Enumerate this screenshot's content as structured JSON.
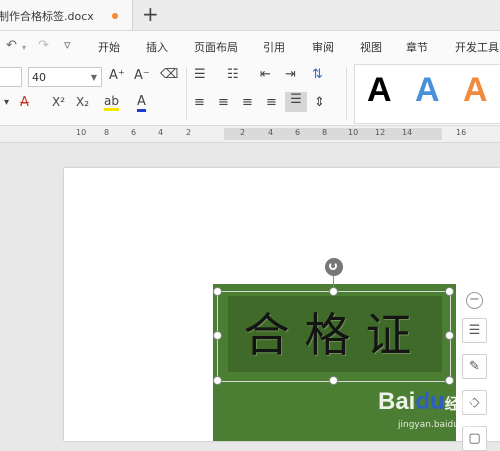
{
  "tabbar": {
    "doc_title": "制作合格标签.docx",
    "new_tab": "+"
  },
  "menu": {
    "items": [
      "开始",
      "插入",
      "页面布局",
      "引用",
      "审阅",
      "视图",
      "章节",
      "开发工具"
    ],
    "undo": "↶",
    "redo": "↷",
    "more": "▿"
  },
  "ribbon": {
    "font_size": "40",
    "grow_font": "A⁺",
    "shrink_font": "A⁻",
    "clear_format": "⌫",
    "strikethrough": "A",
    "superscript": "X²",
    "subscript": "X₂",
    "highlight": "ab",
    "font_color": "A",
    "styles_preview": [
      "A",
      "A",
      "A"
    ]
  },
  "ruler": {
    "numbers": [
      "10",
      "8",
      "6",
      "4",
      "2",
      "2",
      "4",
      "6",
      "8",
      "10",
      "12",
      "14",
      "16"
    ]
  },
  "document": {
    "wordart_text": "合格证"
  },
  "watermark": {
    "brand_a": "Bai",
    "brand_b": "du",
    "suffix": "经验",
    "url": "jingyan.baidu.com"
  },
  "colors": {
    "green_block": "#4b7d32",
    "accent_orange": "#f0883a",
    "style_blue": "#4a90d9",
    "style_orange": "#f08a3c"
  }
}
